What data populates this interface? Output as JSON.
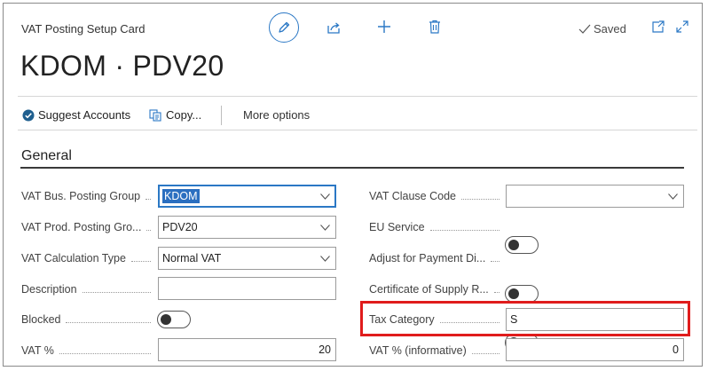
{
  "header": {
    "card_title": "VAT Posting Setup Card",
    "record_title": "KDOM · PDV20",
    "saved_label": "Saved",
    "icons": [
      "edit-icon",
      "share-icon",
      "add-icon",
      "delete-icon",
      "checkmark-icon",
      "open-new-window-icon",
      "expand-icon"
    ]
  },
  "actions": {
    "suggest_accounts": "Suggest Accounts",
    "copy": "Copy...",
    "more_options": "More options"
  },
  "section": {
    "title": "General"
  },
  "left_fields": {
    "vat_bus_posting_group": {
      "label": "VAT Bus. Posting Group",
      "value": "KDOM"
    },
    "vat_prod_posting_group": {
      "label": "VAT Prod. Posting Gro...",
      "value": "PDV20"
    },
    "vat_calculation_type": {
      "label": "VAT Calculation Type",
      "value": "Normal VAT"
    },
    "description": {
      "label": "Description",
      "value": ""
    },
    "blocked": {
      "label": "Blocked",
      "checked": false
    },
    "vat_percent": {
      "label": "VAT %",
      "value": "20"
    }
  },
  "right_fields": {
    "vat_clause_code": {
      "label": "VAT Clause Code",
      "value": ""
    },
    "eu_service": {
      "label": "EU Service",
      "checked": false
    },
    "adjust_for_payment": {
      "label": "Adjust for Payment Di...",
      "checked": false
    },
    "certificate_of_supply": {
      "label": "Certificate of Supply R...",
      "checked": false
    },
    "tax_category": {
      "label": "Tax Category",
      "value": "S"
    },
    "vat_percent_informative": {
      "label": "VAT % (informative)",
      "value": "0"
    }
  },
  "colors": {
    "accent": "#2b78c5",
    "highlight": "#e01c1c",
    "selection": "#2b6fc0"
  }
}
